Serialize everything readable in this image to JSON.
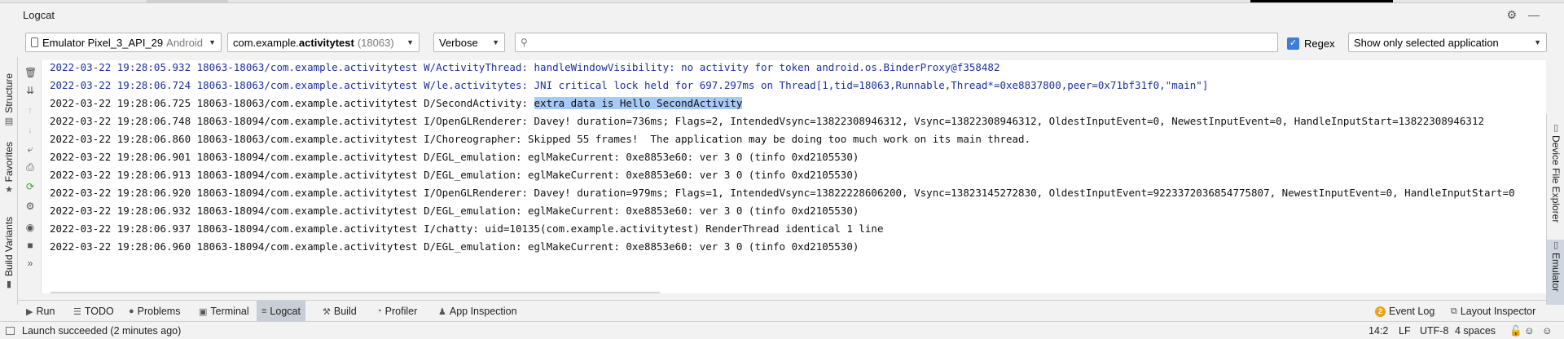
{
  "tool_window": {
    "title": "Logcat",
    "settings_icon": "gear-icon",
    "minimize_icon": "minimize-icon"
  },
  "filters": {
    "device_name": "Emulator Pixel_3_API_29",
    "device_os": "Android",
    "process_prefix": "com.example.",
    "process_bold": "activitytest",
    "process_pid": "(18063)",
    "log_level": "Verbose",
    "search_value": "",
    "regex_label": "Regex",
    "regex_checked": "✓",
    "app_filter": "Show only selected application"
  },
  "left_tool_tabs": {
    "structure": "Structure",
    "favorites": "Favorites",
    "build_variants": "Build Variants"
  },
  "right_tool_tabs": {
    "device_file_explorer": "Device File Explorer",
    "emulator": "Emulator"
  },
  "log_lines": [
    {
      "level": "W",
      "text": "2022-03-22 19:28:05.932 18063-18063/com.example.activitytest W/ActivityThread: handleWindowVisibility: no activity for token android.os.BinderProxy@f358482"
    },
    {
      "level": "W",
      "text": "2022-03-22 19:28:06.724 18063-18063/com.example.activitytest W/le.activitytes: JNI critical lock held for 697.297ms on Thread[1,tid=18063,Runnable,Thread*=0xe8837800,peer=0x71bf31f0,\"main\"]"
    },
    {
      "level": "D",
      "prefix": "2022-03-22 19:28:06.725 18063-18063/com.example.activitytest D/SecondActivity: ",
      "highlight": "extra data is Hello SecondActivity"
    },
    {
      "level": "I",
      "text": "2022-03-22 19:28:06.748 18063-18094/com.example.activitytest I/OpenGLRenderer: Davey! duration=736ms; Flags=2, IntendedVsync=13822308946312, Vsync=13822308946312, OldestInputEvent=0, NewestInputEvent=0, HandleInputStart=13822308946312"
    },
    {
      "level": "I",
      "text": "2022-03-22 19:28:06.860 18063-18063/com.example.activitytest I/Choreographer: Skipped 55 frames!  The application may be doing too much work on its main thread."
    },
    {
      "level": "D",
      "text": "2022-03-22 19:28:06.901 18063-18094/com.example.activitytest D/EGL_emulation: eglMakeCurrent: 0xe8853e60: ver 3 0 (tinfo 0xd2105530)"
    },
    {
      "level": "D",
      "text": "2022-03-22 19:28:06.913 18063-18094/com.example.activitytest D/EGL_emulation: eglMakeCurrent: 0xe8853e60: ver 3 0 (tinfo 0xd2105530)"
    },
    {
      "level": "I",
      "text": "2022-03-22 19:28:06.920 18063-18094/com.example.activitytest I/OpenGLRenderer: Davey! duration=979ms; Flags=1, IntendedVsync=13822228606200, Vsync=13823145272830, OldestInputEvent=9223372036854775807, NewestInputEvent=0, HandleInputStart=0"
    },
    {
      "level": "D",
      "text": "2022-03-22 19:28:06.932 18063-18094/com.example.activitytest D/EGL_emulation: eglMakeCurrent: 0xe8853e60: ver 3 0 (tinfo 0xd2105530)"
    },
    {
      "level": "I",
      "text": "2022-03-22 19:28:06.937 18063-18094/com.example.activitytest I/chatty: uid=10135(com.example.activitytest) RenderThread identical 1 line"
    },
    {
      "level": "D",
      "text": "2022-03-22 19:28:06.960 18063-18094/com.example.activitytest D/EGL_emulation: eglMakeCurrent: 0xe8853e60: ver 3 0 (tinfo 0xd2105530)"
    }
  ],
  "bottom_tabs": {
    "run": "Run",
    "todo": "TODO",
    "problems": "Problems",
    "terminal": "Terminal",
    "logcat": "Logcat",
    "build": "Build",
    "profiler": "Profiler",
    "app_inspection": "App Inspection",
    "event_log_count": "2",
    "event_log": "Event Log",
    "layout_inspector": "Layout Inspector"
  },
  "status": {
    "message": "Launch succeeded (2 minutes ago)",
    "position": "14:2",
    "line_separator": "LF",
    "encoding": "UTF-8",
    "indent": "4 spaces"
  }
}
